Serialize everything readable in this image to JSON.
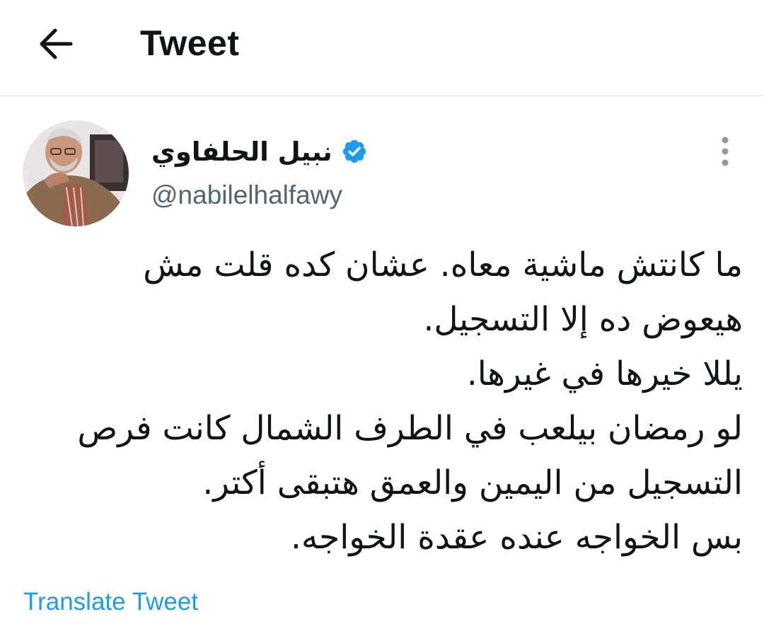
{
  "header": {
    "title": "Tweet",
    "back_icon": "arrow-left-icon"
  },
  "author": {
    "display_name": "نبيل الحلفاوي",
    "verified": true,
    "handle": "@nabilelhalfawy",
    "avatar_icon": "profile-photo",
    "accent_color": "#1d9bf0"
  },
  "more_icon": "more-vertical-icon",
  "tweet": {
    "lines": [
      "ما كانتش ماشية معاه. عشان كده قلت مش",
      "هيعوض ده إلا التسجيل.",
      "يللا خيرها في غيرها.",
      "لو رمضان بيلعب في الطرف الشمال كانت فرص",
      "التسجيل من اليمين والعمق هتبقى أكتر.",
      "بس الخواجه عنده عقدة الخواجه."
    ]
  },
  "translate_label": "Translate Tweet"
}
